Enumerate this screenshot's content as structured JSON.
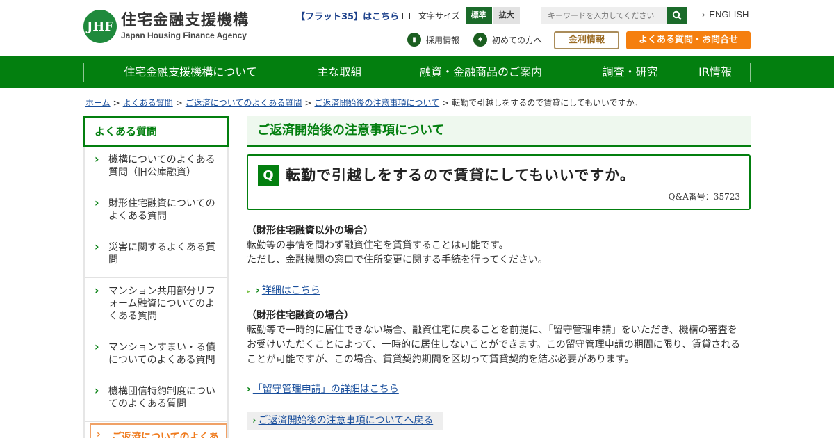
{
  "header": {
    "logo_mark": "JHF",
    "logo_ja": "住宅金融支援機構",
    "logo_en": "Japan Housing Finance Agency",
    "flat35_label": "【フラット35】はこちら",
    "fontsize_label": "文字サイズ",
    "fontsize_standard": "標準",
    "fontsize_large": "拡大",
    "search_placeholder": "キーワードを入力してください",
    "english_label": "ENGLISH",
    "recruit_label": "採用情報",
    "beginners_label": "初めての方へ",
    "rate_button": "金利情報",
    "faq_button": "よくある質問・お問合せ"
  },
  "gnav": [
    {
      "label": "住宅金融支援機構について"
    },
    {
      "label": "主な取組"
    },
    {
      "label": "融資・金融商品のご案内"
    },
    {
      "label": "調査・研究"
    },
    {
      "label": "IR情報"
    }
  ],
  "breadcrumb": [
    {
      "label": "ホーム",
      "link": true
    },
    {
      "label": "よくある質問",
      "link": true
    },
    {
      "label": "ご返済についてのよくある質問",
      "link": true
    },
    {
      "label": "ご返済開始後の注意事項について",
      "link": true
    },
    {
      "label": "転勤で引越しをするので賃貸にしてもいいですか。",
      "link": false
    }
  ],
  "sidebar": {
    "title": "よくある質問",
    "items": [
      {
        "line1": "機構についてのよくある",
        "line2": "質問（旧公庫融資）"
      },
      {
        "line1": "財形住宅融資についての",
        "line2": "よくある質問"
      },
      {
        "line1": "災害に関するよくある質",
        "line2": "問"
      },
      {
        "line1": "マンション共用部分リフ",
        "line2": "ォーム融資についてのよ",
        "line3": "くある質問"
      },
      {
        "line1": "マンションすまい・る債",
        "line2": "についてのよくある質問"
      },
      {
        "line1": "機構団信特約制度につい",
        "line2": "てのよくある質問"
      }
    ],
    "active_item": "ご返済についてのよくあ"
  },
  "main": {
    "section_title": "ご返済開始後の注意事項について",
    "q_mark": "Q",
    "question": "転勤で引越しをするので賃貸にしてもいいですか。",
    "qa_number": "Q&A番号：35723",
    "para1_heading": "（財形住宅融資以外の場合）",
    "para1_line1": "転勤等の事情を問わず融資住宅を賃貸することは可能です。",
    "para1_line2": "ただし、金融機関の窓口で住所変更に関する手続を行ってください。",
    "link1": "詳細はこちら",
    "para2_heading": "（財形住宅融資の場合）",
    "para2_line1": "転勤等で一時的に居住できない場合、融資住宅に戻ることを前提に、「留守管理申請」をいただき、機構の審査を",
    "para2_line2": "お受けいただくことによって、一時的に居住しないことができます。この留守管理申請の期間に限り、賃貸される",
    "para2_line3": "ことが可能ですが、この場合、賃貸契約期間を区切って賃貸契約を結ぶ必要があります。",
    "link2": "「留守管理申請」の詳細はこちら",
    "back_link": "ご返済開始後の注意事項についてへ戻る"
  },
  "colors": {
    "brand_green": "#037f0f",
    "accent_orange": "#f57f0f",
    "link_blue": "#1a4f9c"
  }
}
